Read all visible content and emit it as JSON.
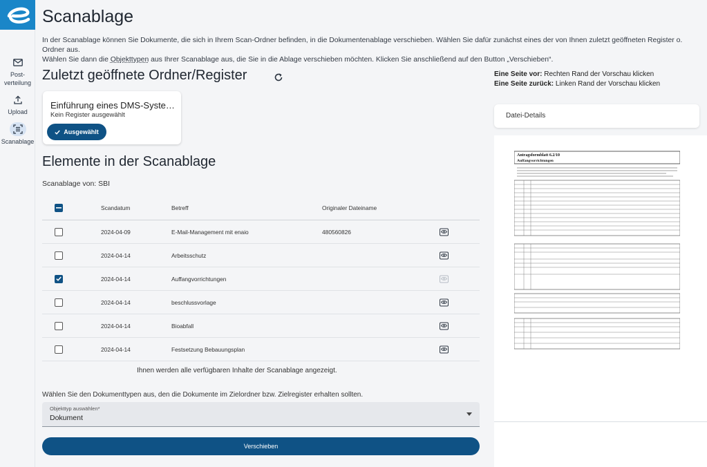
{
  "sidebar": {
    "items": [
      {
        "label_line1": "Post-",
        "label_line2": "verteilung",
        "icon": "mail-icon"
      },
      {
        "label": "Upload",
        "icon": "upload-icon"
      },
      {
        "label": "Scanablage",
        "icon": "scan-icon"
      }
    ]
  },
  "page": {
    "title": "Scanablage",
    "intro_line1": "In der Scanablage können Sie Dokumente, die sich in Ihrem Scan-Ordner befinden, in die Dokumentenablage verschieben. Wählen Sie dafür zunächst eines der von Ihnen zuletzt geöffneten Register o. Ordner aus.",
    "intro_line2_a": "Wählen Sie dann die ",
    "intro_line2_link": "Objekttypen",
    "intro_line2_b": " aus Ihrer Scanablage aus, die Sie in die Ablage verschieben möchten. Klicken Sie anschließend auf den Button „Verschieben“."
  },
  "recent": {
    "heading": "Zuletzt geöffnete Ordner/Register",
    "card": {
      "title": "Einführung eines DMS-Systems",
      "subtitle": "Kein Register ausgewählt",
      "button": "Ausgewählt"
    }
  },
  "elements": {
    "heading": "Elemente in der Scanablage",
    "from_label": "Scanablage von: SBI",
    "columns": {
      "date": "Scandatum",
      "subject": "Betreff",
      "filename": "Originaler Dateiname"
    },
    "rows": [
      {
        "date": "2024-04-09",
        "subject": "E-Mail-Management mit enaio",
        "filename": "480560826",
        "checked": false
      },
      {
        "date": "2024-04-14",
        "subject": "Arbeitsschutz",
        "filename": "",
        "checked": false
      },
      {
        "date": "2024-04-14",
        "subject": "Auffangvorrichtungen",
        "filename": "",
        "checked": true
      },
      {
        "date": "2024-04-14",
        "subject": "beschlussvorlage",
        "filename": "",
        "checked": false
      },
      {
        "date": "2024-04-14",
        "subject": "Bioabfall",
        "filename": "",
        "checked": false
      },
      {
        "date": "2024-04-14",
        "subject": "Festsetzung Bebauungsplan",
        "filename": "",
        "checked": false
      }
    ],
    "all_shown": "Ihnen werden alle verfügbaren Inhalte der Scanablage angezeigt."
  },
  "doctype": {
    "prompt": "Wählen Sie den Dokumenttypen aus, den die Dokumente im Zielordner bzw. Zielregister erhalten sollten.",
    "select_label": "Objekttyp auswählen*",
    "select_value": "Dokument"
  },
  "move_button": "Verschieben",
  "preview": {
    "hint1_bold": "Eine Seite vor:",
    "hint1_text": " Rechten Rand der Vorschau klicken",
    "hint2_bold": "Eine Seite zurück:",
    "hint2_text": " Linken Rand der Vorschau klicken",
    "details_label": "Datei-Details",
    "doc_title": "Antragsformblatt 6.2/10",
    "doc_subtitle": "Auffangvorrichtungen"
  },
  "colors": {
    "primary": "#0f5285",
    "logo_bg": "#1a86c8",
    "nav_active": "#d6e3f3"
  }
}
